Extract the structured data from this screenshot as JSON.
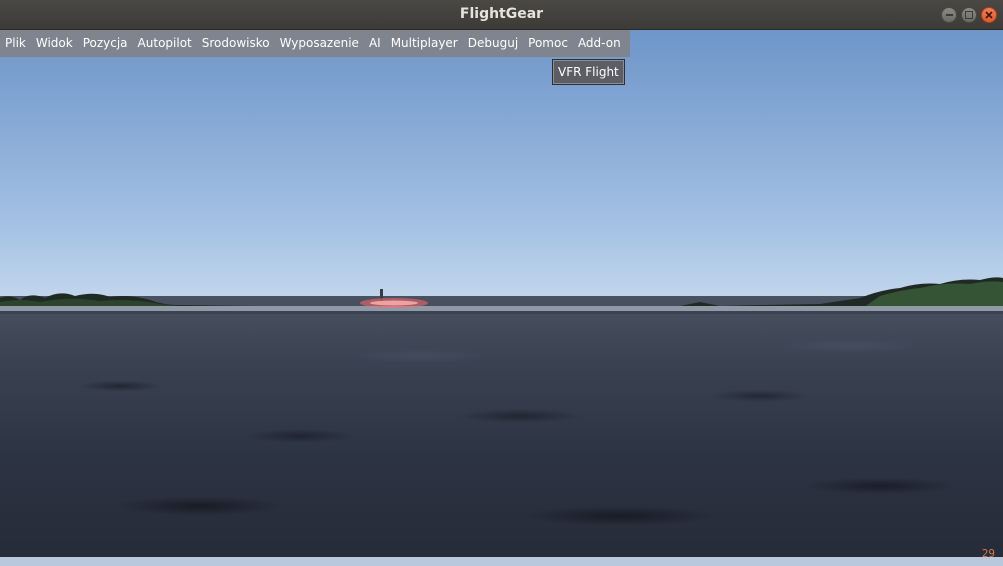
{
  "window": {
    "title": "FlightGear",
    "controls": {
      "minimize_icon": "minimize-icon",
      "maximize_icon": "maximize-icon",
      "close_icon": "close-icon"
    }
  },
  "menubar": {
    "items": [
      {
        "label": "Plik"
      },
      {
        "label": "Widok"
      },
      {
        "label": "Pozycja"
      },
      {
        "label": "Autopilot"
      },
      {
        "label": "Srodowisko"
      },
      {
        "label": "Wyposazenie"
      },
      {
        "label": "AI"
      },
      {
        "label": "Multiplayer"
      },
      {
        "label": "Debuguj"
      },
      {
        "label": "Pomoc"
      },
      {
        "label": "Add-on"
      }
    ]
  },
  "addon_menu": {
    "items": [
      {
        "label": "VFR Flight"
      }
    ]
  },
  "hud": {
    "fps": "29"
  },
  "colors": {
    "sky_top": "#6e96c8",
    "sky_horizon": "#c2d6ec",
    "sea": "#2c3342",
    "menu_bg": "#80828a",
    "fps_text": "#d9764a",
    "close_button": "#e25a2b"
  }
}
